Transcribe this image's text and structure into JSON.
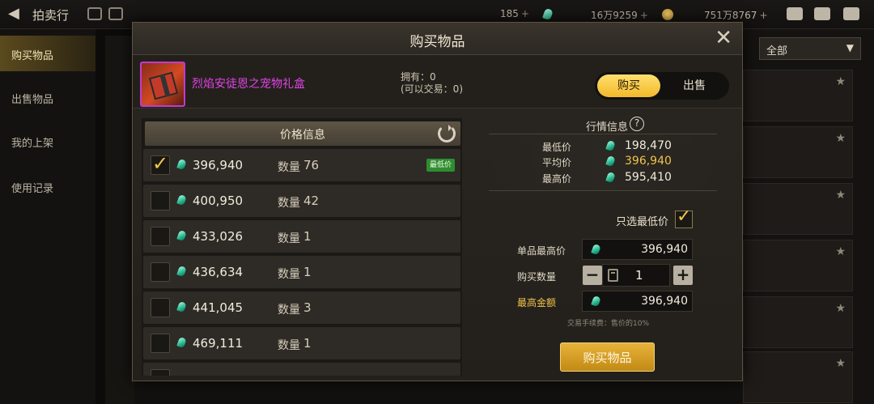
{
  "topbar": {
    "title": "拍卖行",
    "currency1": "185",
    "currency2": "16万9259",
    "currency3": "751万8767"
  },
  "sidebar": {
    "items": [
      {
        "label": "购买物品"
      },
      {
        "label": "出售物品"
      },
      {
        "label": "我的上架"
      },
      {
        "label": "使用记录"
      }
    ]
  },
  "right_panel": {
    "filter": "全部"
  },
  "modal": {
    "title": "购买物品",
    "item_name": "烈焰安徒恩之宠物礼盒",
    "owned_line1": "拥有：0",
    "owned_line2": "(可以交易：0)",
    "toggle_buy": "购买",
    "toggle_sell": "出售",
    "price_header": "价格信息",
    "qty_label": "数量",
    "lowest_badge": "最低价",
    "listings": [
      {
        "price": "396,940",
        "qty": "76",
        "checked": true,
        "lowest": true
      },
      {
        "price": "400,950",
        "qty": "42",
        "checked": false,
        "lowest": false
      },
      {
        "price": "433,026",
        "qty": "1",
        "checked": false,
        "lowest": false
      },
      {
        "price": "436,634",
        "qty": "1",
        "checked": false,
        "lowest": false
      },
      {
        "price": "441,045",
        "qty": "3",
        "checked": false,
        "lowest": false
      },
      {
        "price": "469,111",
        "qty": "1",
        "checked": false,
        "lowest": false
      }
    ],
    "market": {
      "title": "行情信息",
      "min_label": "最低价",
      "min_val": "198,470",
      "avg_label": "平均价",
      "avg_val": "396,940",
      "max_label": "最高价",
      "max_val": "595,410"
    },
    "only_lowest_label": "只选最低价",
    "unit_max_label": "单品最高价",
    "unit_max_val": "396,940",
    "buy_qty_label": "购买数量",
    "buy_qty_val": "1",
    "max_total_label": "最高金额",
    "max_total_val": "396,940",
    "fee_note": "交易手续费：售价的10%",
    "buy_button": "购买物品"
  }
}
